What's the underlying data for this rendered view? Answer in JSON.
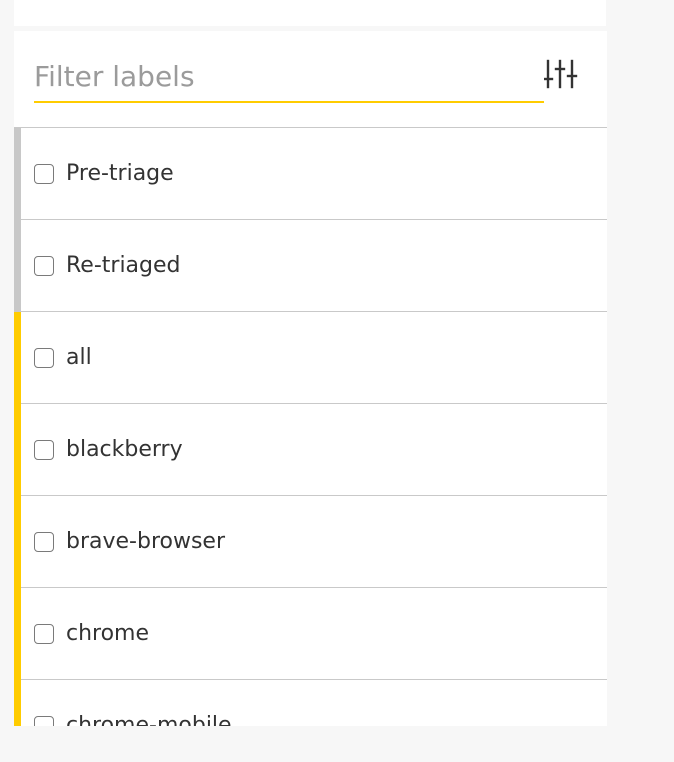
{
  "filter": {
    "placeholder": "Filter labels",
    "value": "",
    "settings_icon": "sliders-icon",
    "underline_color": "#ffcc00"
  },
  "labels": [
    {
      "name": "Pre-triage",
      "checked": false,
      "color": "#c8c8c8"
    },
    {
      "name": "Re-triaged",
      "checked": false,
      "color": "#c8c8c8"
    },
    {
      "name": "all",
      "checked": false,
      "color": "#ffcc00"
    },
    {
      "name": "blackberry",
      "checked": false,
      "color": "#ffcc00"
    },
    {
      "name": "brave-browser",
      "checked": false,
      "color": "#ffcc00"
    },
    {
      "name": "chrome",
      "checked": false,
      "color": "#ffcc00"
    },
    {
      "name": "chrome-mobile",
      "checked": false,
      "color": "#ffcc00"
    }
  ]
}
